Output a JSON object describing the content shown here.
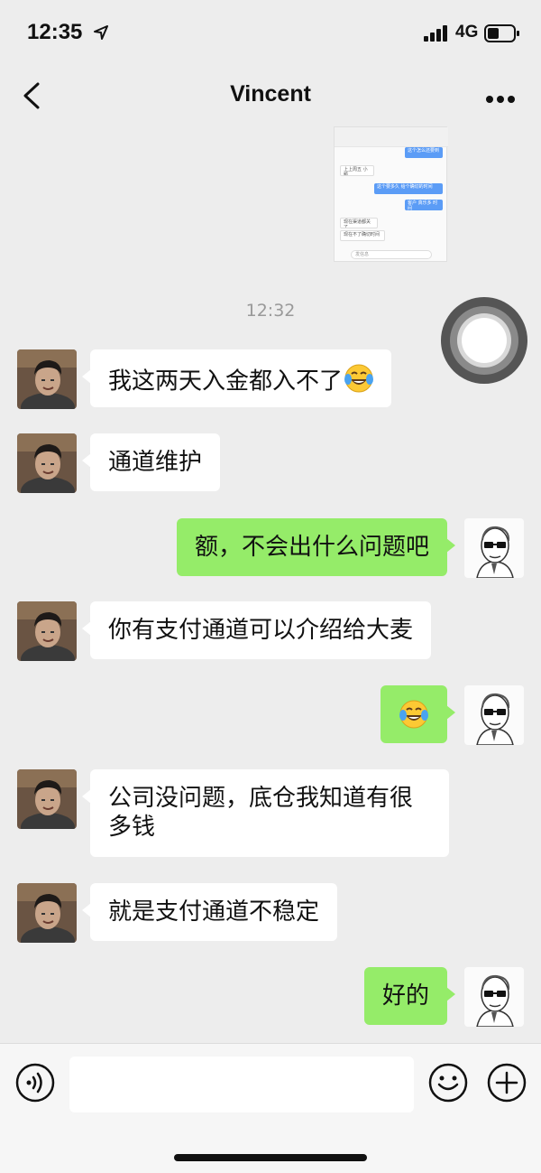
{
  "status_bar": {
    "time": "12:35",
    "network": "4G"
  },
  "nav": {
    "title": "Vincent"
  },
  "screenshot_thumb": {
    "messages": [
      {
        "side": "right",
        "text": "这个怎么还要到"
      },
      {
        "side": "left",
        "text": "上上周五 小额"
      },
      {
        "side": "right",
        "text": "这个要多久 给个确切的时间"
      },
      {
        "side": "right",
        "text": "客户 真乐多 时间"
      },
      {
        "side": "left",
        "text": "现在渠道都关了"
      },
      {
        "side": "left",
        "text": "现在不了确切时间"
      }
    ],
    "input_placeholder": "发信息"
  },
  "time_divider": "12:32",
  "messages": [
    {
      "side": "in",
      "text": "我这两天入金都入不了",
      "emoji": "laughing-crying-emoji"
    },
    {
      "side": "in",
      "text": "通道维护"
    },
    {
      "side": "out",
      "text": "额，不会出什么问题吧"
    },
    {
      "side": "in",
      "text": "你有支付通道可以介绍给大麦"
    },
    {
      "side": "out",
      "text": "",
      "emoji": "tears-of-joy-emoji"
    },
    {
      "side": "in",
      "text": "公司没问题，底仓我知道有很多钱"
    },
    {
      "side": "in",
      "text": "就是支付通道不稳定"
    },
    {
      "side": "out",
      "text": "好的"
    }
  ],
  "colors": {
    "background": "#ededed",
    "outgoing_bubble": "#95ec69",
    "incoming_bubble": "#ffffff"
  }
}
